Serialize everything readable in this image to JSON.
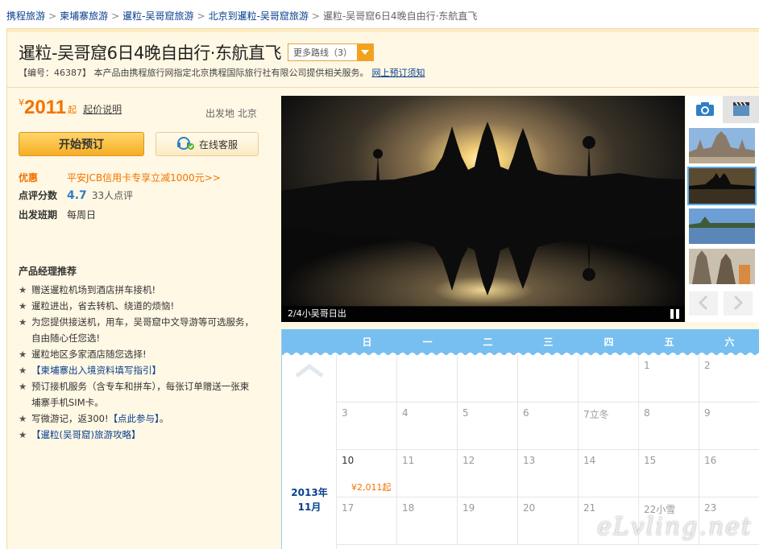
{
  "breadcrumb": [
    {
      "label": "携程旅游"
    },
    {
      "label": "柬埔寨旅游"
    },
    {
      "label": "暹粒-吴哥窟旅游"
    },
    {
      "label": "北京到暹粒-吴哥窟旅游"
    }
  ],
  "breadcrumb_current": "暹粒-吴哥窟6日4晚自由行·东航直飞",
  "product": {
    "title": "暹粒-吴哥窟6日4晚自由行·东航直飞",
    "more_routes": "更多路线（3）",
    "code_text": "【编号：46387】 本产品由携程旅行网指定北京携程国际旅行社有限公司提供相关服务。",
    "booking_notice": "网上预订须知"
  },
  "price": {
    "currency": "¥",
    "amount": "2011",
    "suffix": "起",
    "note": "起价说明",
    "departure": "出发地 北京"
  },
  "buttons": {
    "book": "开始预订",
    "service": "在线客服"
  },
  "info": {
    "promo_label": "优惠",
    "promo_text": "平安JCB信用卡专享立减1000元>>",
    "rating_label": "点评分数",
    "rating_value": "4.7",
    "rating_count": "33人点评",
    "schedule_label": "出发班期",
    "schedule_value": "每周日"
  },
  "recommend": {
    "title": "产品经理推荐",
    "items": [
      {
        "text": "赠送暹粒机场到酒店拼车接机!",
        "link": false
      },
      {
        "text": "暹粒进出，省去转机、绕道的烦恼!",
        "link": false
      },
      {
        "text": "为您提供接送机，用车，吴哥窟中文导游等可选服务，",
        "link": false
      },
      {
        "text": "自由随心任您选!",
        "link": false,
        "indent": true
      },
      {
        "text": "暹粒地区多家酒店随您选择!",
        "link": false
      },
      {
        "text": "【柬埔寨出入境资料填写指引】",
        "link": true
      },
      {
        "text": "预订接机服务（含专车和拼车），每张订单赠送一张柬",
        "link": false
      },
      {
        "text": "埔寨手机SIM卡。",
        "link": false,
        "indent": true
      },
      {
        "text": "写微游记，返300!",
        "link": false,
        "suffix_link": "【点此参与】",
        "suffix_tail": "。"
      },
      {
        "text": "【暹粒(吴哥窟)旅游攻略】",
        "link": true
      }
    ]
  },
  "gallery": {
    "caption": "2/4小吴哥日出",
    "thumbs": [
      "angkor-temple",
      "angkor-sunrise",
      "lake-reflection",
      "temple-towers"
    ]
  },
  "calendar": {
    "weekdays": [
      "日",
      "一",
      "二",
      "三",
      "四",
      "五",
      "六"
    ],
    "year_month": "2013年",
    "month": "11月",
    "rows": [
      [
        "",
        "",
        "",
        "",
        "",
        "1",
        "2"
      ],
      [
        "3",
        "4",
        "5",
        "6",
        "7立冬",
        "8",
        "9"
      ],
      [
        "10",
        "11",
        "12",
        "13",
        "14",
        "15",
        "16"
      ],
      [
        "17",
        "18",
        "19",
        "20",
        "21",
        "22小雪",
        "23"
      ]
    ],
    "price_cell": {
      "row": 2,
      "col": 0,
      "text": "¥2,011起"
    }
  },
  "watermark": "eLvling.net",
  "colors": {
    "accent": "#f27300",
    "link": "#0a3f8f",
    "calendar_header": "#77bff0",
    "card_bg": "#fff8e4"
  }
}
